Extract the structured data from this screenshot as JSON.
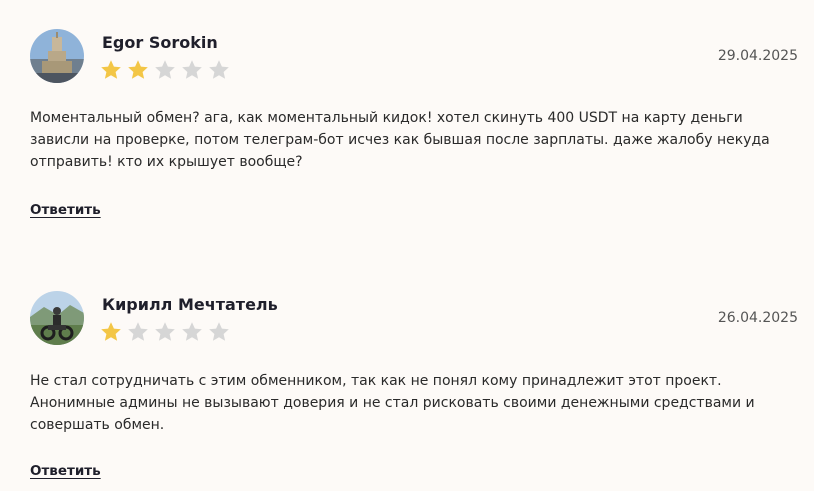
{
  "reviews": [
    {
      "author": "Egor Sorokin",
      "date": "29.04.2025",
      "rating": 2,
      "max_rating": 5,
      "text": "Моментальный обмен? ага, как моментальный кидок! хотел скинуть 400 USDT на карту деньги зависли на проверке, потом телеграм-бот исчез как бывшая после зарплаты. даже жалобу некуда отправить! кто их крышует вообще?",
      "reply_label": "Ответить",
      "avatar_icon": "avatar-photo-tower"
    },
    {
      "author": "Кирилл Мечтатель",
      "date": "26.04.2025",
      "rating": 1,
      "max_rating": 5,
      "text": "Не стал сотрудничать с этим обменником, так как не понял кому принадлежит этот проект. Анонимные админы не вызывают доверия и не стал рисковать своими денежными средствами и совершать обмен.",
      "reply_label": "Ответить",
      "avatar_icon": "avatar-photo-motorcycle"
    }
  ],
  "colors": {
    "star_filled": "#f3c646",
    "star_empty": "#d6d6d6",
    "background": "#fdfaf7"
  }
}
